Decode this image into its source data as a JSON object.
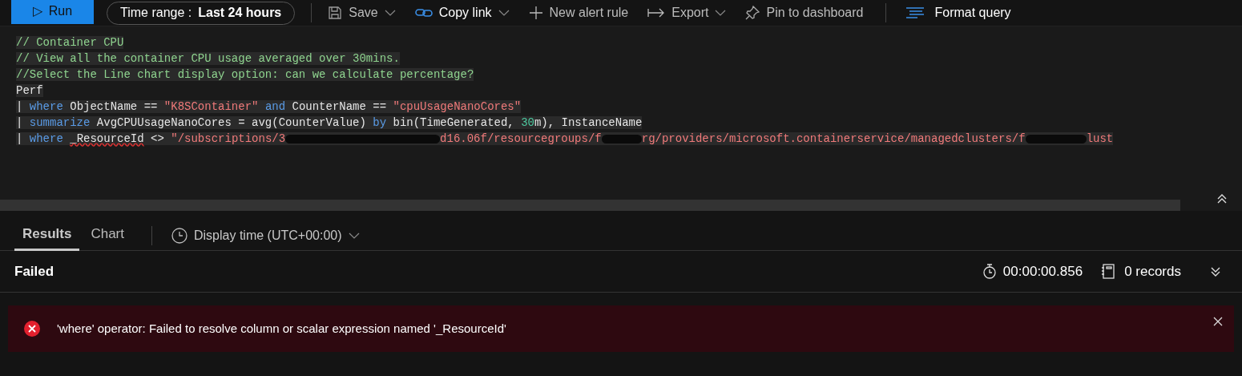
{
  "toolbar": {
    "run": {
      "label": "Run",
      "icon": "▷"
    },
    "time_range": {
      "label": "Time range :",
      "value": "Last 24 hours"
    },
    "actions": [
      {
        "label": "Save",
        "kind": "save",
        "dropdown": true
      },
      {
        "label": "Copy link",
        "kind": "link",
        "dropdown": true
      },
      {
        "label": "New alert rule",
        "kind": "plus",
        "dropdown": false
      },
      {
        "label": "Export",
        "kind": "export",
        "dropdown": true
      },
      {
        "label": "Pin to dashboard",
        "kind": "pin",
        "dropdown": false
      }
    ],
    "format": {
      "label": "Format query"
    }
  },
  "editor": {
    "lines": [
      [
        {
          "kind": "comment",
          "text": "// Container CPU"
        }
      ],
      [
        {
          "kind": "comment",
          "text": "// View all the container CPU usage averaged over 30mins."
        }
      ],
      [
        {
          "kind": "comment",
          "text": "//Select the Line chart display option: can we calculate percentage?"
        }
      ],
      [
        {
          "kind": "plain",
          "text": "Perf"
        }
      ],
      [
        {
          "kind": "plain",
          "text": "| "
        },
        {
          "kind": "keyword",
          "text": "where"
        },
        {
          "kind": "plain",
          "text": " ObjectName == "
        },
        {
          "kind": "string",
          "text": "\"K8SContainer\""
        },
        {
          "kind": "keyword",
          "text": " and"
        },
        {
          "kind": "plain",
          "text": " CounterName == "
        },
        {
          "kind": "string",
          "text": "\"cpuUsageNanoCores\""
        }
      ],
      [
        {
          "kind": "plain",
          "text": "| "
        },
        {
          "kind": "keyword",
          "text": "summarize"
        },
        {
          "kind": "plain",
          "text": " AvgCPUUsageNanoCores = avg(CounterValue) "
        },
        {
          "kind": "keyword",
          "text": "by"
        },
        {
          "kind": "plain",
          "text": " bin(TimeGenerated, "
        },
        {
          "kind": "number",
          "text": "30"
        },
        {
          "kind": "plain",
          "text": "m), InstanceName"
        }
      ],
      [
        {
          "kind": "plain",
          "text": "| "
        },
        {
          "kind": "keyword",
          "text": "where "
        },
        {
          "kind": "error",
          "text": "_ResourceId"
        },
        {
          "kind": "plain",
          "text": " <> "
        },
        {
          "kind": "string",
          "text": "\"/subscriptions/3"
        },
        {
          "kind": "redacted"
        },
        {
          "kind": "string",
          "text": "d16.06f/resourcegroups/f"
        },
        {
          "kind": "redacted"
        },
        {
          "kind": "string",
          "text": "rg/providers/microsoft.containerservice/managedclusters/f"
        },
        {
          "kind": "redacted"
        },
        {
          "kind": "string",
          "text": "lust"
        }
      ]
    ]
  },
  "results": {
    "tabs": [
      {
        "label": "Results",
        "selected": true
      },
      {
        "label": "Chart",
        "selected": false
      }
    ],
    "display_time": "Display time (UTC+00:00)",
    "status": "Failed",
    "duration": "00:00:00.856",
    "records": "0 records",
    "error": {
      "message": "'where' operator: Failed to resolve column or scalar expression named '_ResourceId'"
    }
  }
}
